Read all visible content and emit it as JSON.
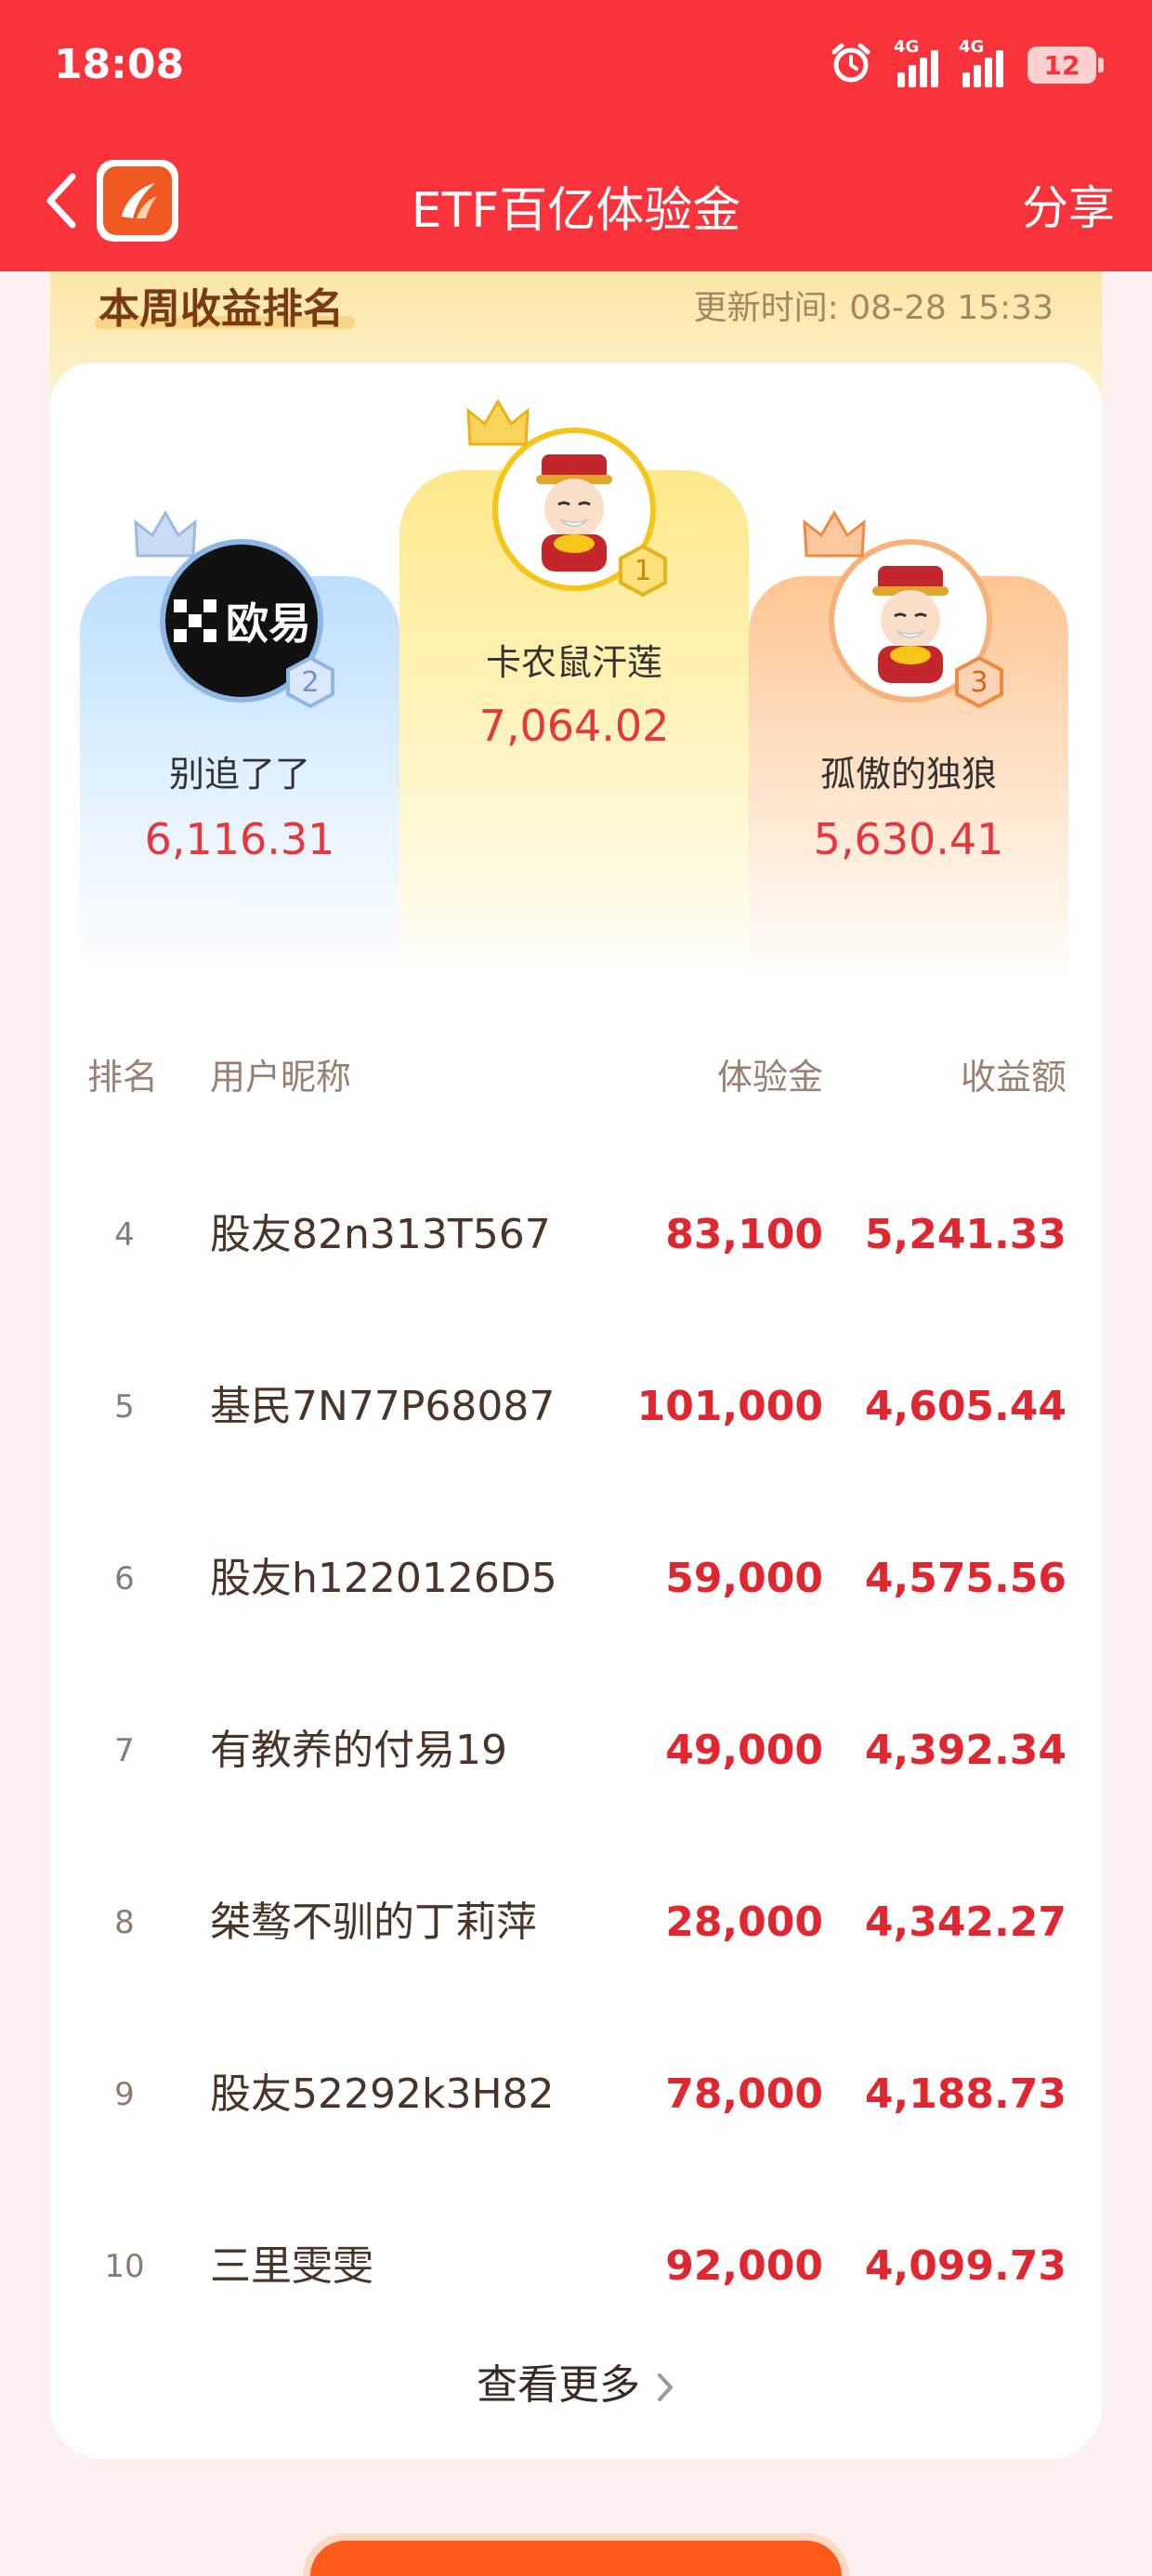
{
  "status": {
    "time": "18:08",
    "network_1": "4G",
    "network_2": "4G",
    "battery": "12",
    "icons": [
      "alarm-icon",
      "signal-icon",
      "signal-icon",
      "battery-icon"
    ]
  },
  "nav": {
    "title": "ETF百亿体验金",
    "share": "分享",
    "back_icon": "chevron-left-icon",
    "logo_icon": "app-logo-icon"
  },
  "weekly": {
    "title": "本周收益排名",
    "update_time": "更新时间: 08-28 15:33"
  },
  "podium": [
    {
      "rank": "2",
      "name": "别追了了",
      "value": "6,116.31",
      "avatar_text": "欧易",
      "color": "#8fb7e6"
    },
    {
      "rank": "1",
      "name": "卡农鼠汗莲",
      "value": "7,064.02",
      "color": "#f5c518"
    },
    {
      "rank": "3",
      "name": "孤傲的独狼",
      "value": "5,630.41",
      "color": "#f08a3e"
    }
  ],
  "table": {
    "headers": {
      "rank": "排名",
      "user": "用户昵称",
      "exp": "体验金",
      "profit": "收益额"
    },
    "rows": [
      {
        "rank": "4",
        "user": "股友82n313T567",
        "exp": "83,100",
        "profit": "5,241.33"
      },
      {
        "rank": "5",
        "user": "基民7N77P68087",
        "exp": "101,000",
        "profit": "4,605.44"
      },
      {
        "rank": "6",
        "user": "股友h1220126D5",
        "exp": "59,000",
        "profit": "4,575.56"
      },
      {
        "rank": "7",
        "user": "有教养的付易19",
        "exp": "49,000",
        "profit": "4,392.34"
      },
      {
        "rank": "8",
        "user": "桀骜不驯的丁莉萍",
        "exp": "28,000",
        "profit": "4,342.27"
      },
      {
        "rank": "9",
        "user": "股友52292k3H82",
        "exp": "78,000",
        "profit": "4,188.73"
      },
      {
        "rank": "10",
        "user": "三里雯雯",
        "exp": "92,000",
        "profit": "4,099.73"
      }
    ]
  },
  "more": "查看更多",
  "colors": {
    "brand_red": "#f8333c",
    "value_red": "#e0262e",
    "gold": "#f5c518"
  }
}
